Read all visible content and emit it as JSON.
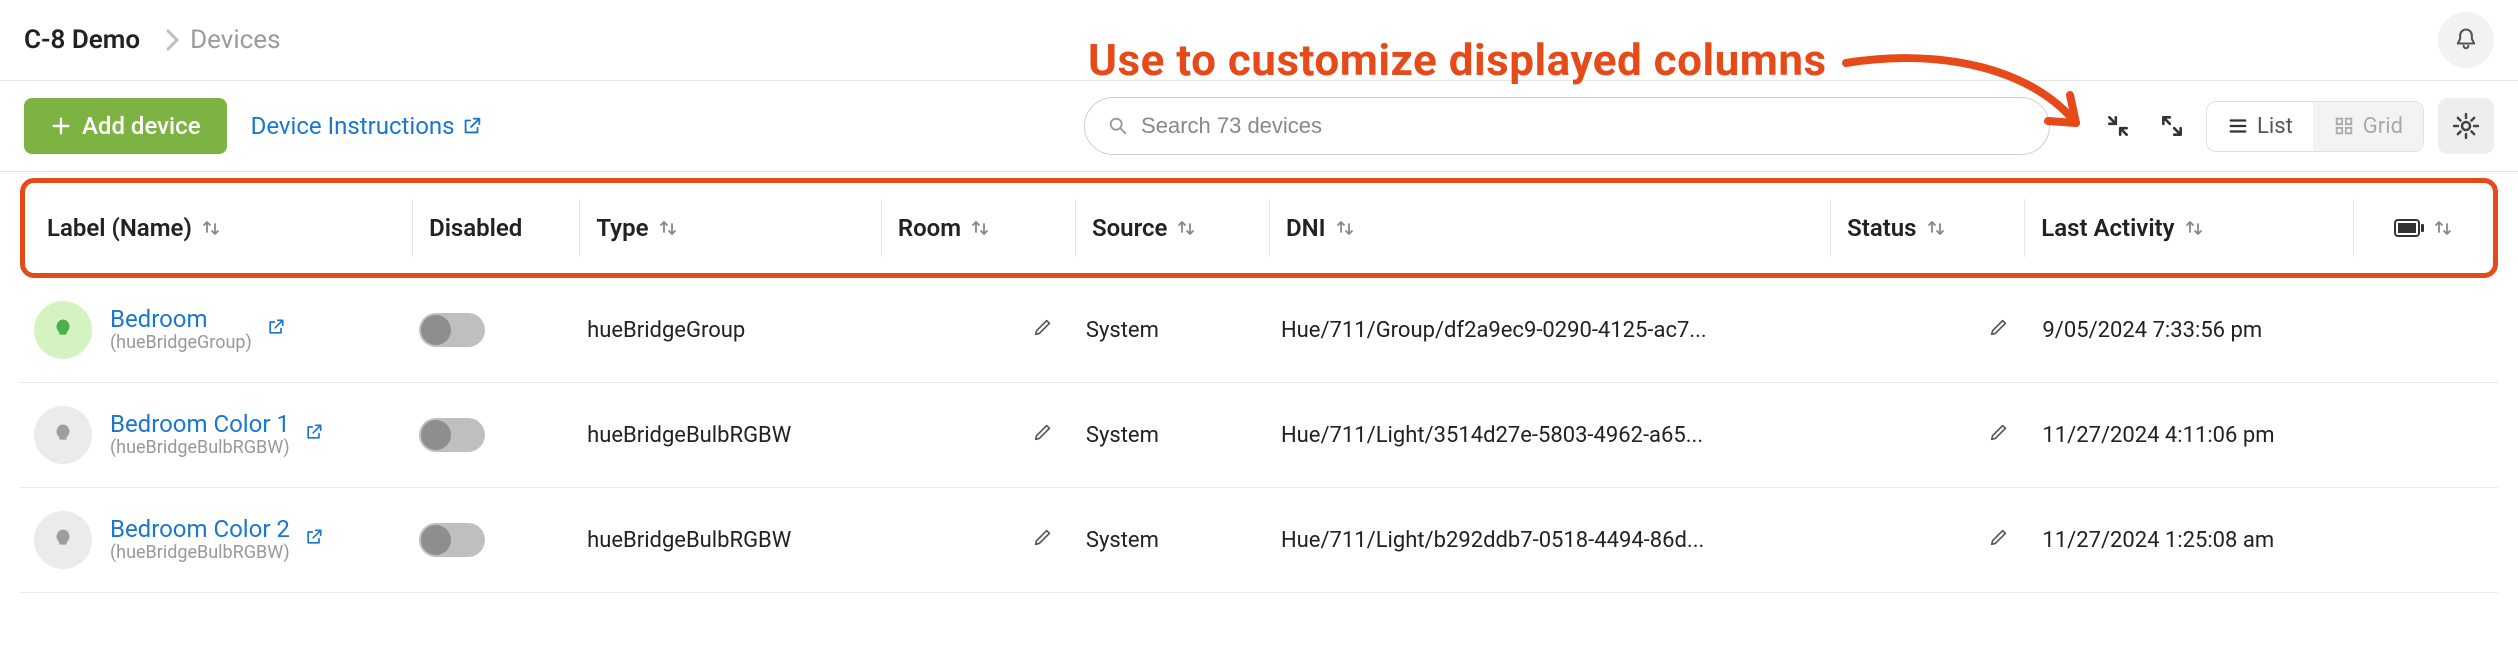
{
  "breadcrumb": {
    "root": "C-8 Demo",
    "leaf": "Devices"
  },
  "annotation": "Use to customize displayed columns",
  "toolbar": {
    "add_label": "Add device",
    "instructions_label": "Device Instructions",
    "search_placeholder": "Search 73 devices",
    "view_list": "List",
    "view_grid": "Grid"
  },
  "columns": {
    "label": "Label (Name)",
    "disabled": "Disabled",
    "type": "Type",
    "room": "Room",
    "source": "Source",
    "dni": "DNI",
    "status": "Status",
    "activity": "Last Activity"
  },
  "rows": [
    {
      "icon_state": "on",
      "label": "Bedroom",
      "subtype": "(hueBridgeGroup)",
      "type": "hueBridgeGroup",
      "room": "",
      "source": "System",
      "dni": "Hue/711/Group/df2a9ec9-0290-4125-ac7...",
      "status": "",
      "activity": "9/05/2024 7:33:56 pm"
    },
    {
      "icon_state": "off",
      "label": "Bedroom Color 1",
      "subtype": "(hueBridgeBulbRGBW)",
      "type": "hueBridgeBulbRGBW",
      "room": "",
      "source": "System",
      "dni": "Hue/711/Light/3514d27e-5803-4962-a65...",
      "status": "",
      "activity": "11/27/2024 4:11:06 pm"
    },
    {
      "icon_state": "off",
      "label": "Bedroom Color 2",
      "subtype": "(hueBridgeBulbRGBW)",
      "type": "hueBridgeBulbRGBW",
      "room": "",
      "source": "System",
      "dni": "Hue/711/Light/b292ddb7-0518-4494-86d...",
      "status": "",
      "activity": "11/27/2024 1:25:08 am"
    }
  ]
}
